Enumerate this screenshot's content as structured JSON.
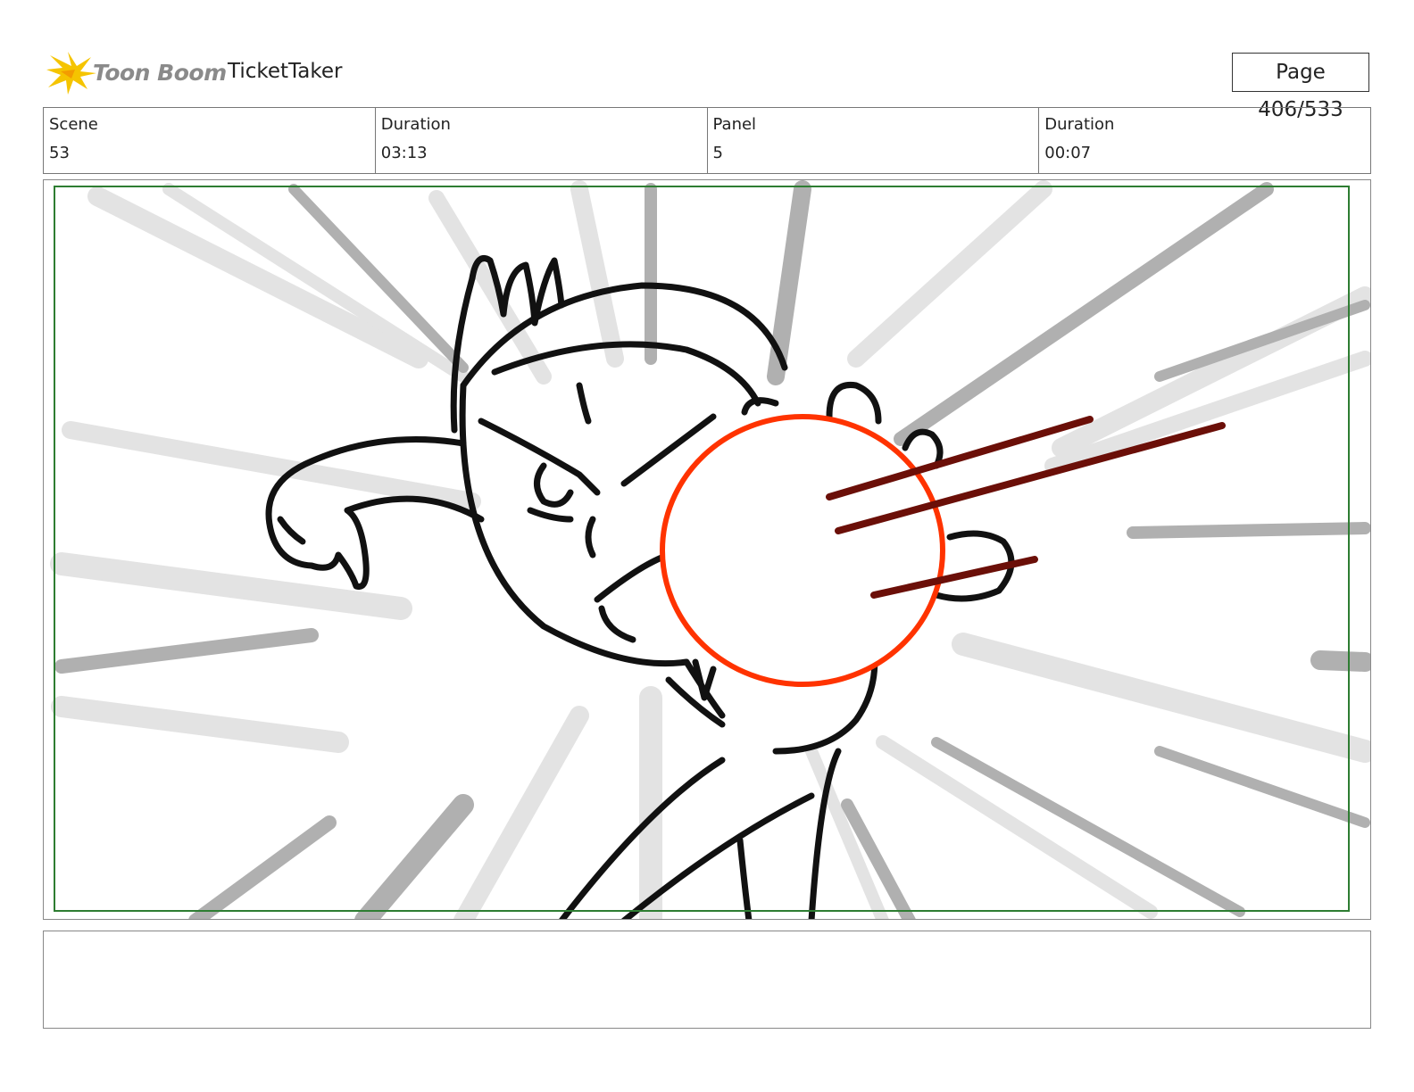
{
  "header": {
    "logo_text": "Toon Boom",
    "project_title": "TicketTaker",
    "page_label": "Page 406/533"
  },
  "info": {
    "scene_label": "Scene",
    "scene_value": "53",
    "scene_duration_label": "Duration",
    "scene_duration_value": "03:13",
    "panel_label": "Panel",
    "panel_value": "5",
    "panel_duration_label": "Duration",
    "panel_duration_value": "00:07"
  },
  "colors": {
    "logo_star": "#f5c400",
    "safe_frame": "#2e7d32",
    "impact_circle": "#ff3300",
    "speed_lines": "#6b0f08",
    "burst_light": "#e3e3e3",
    "burst_dark": "#b0b0b0"
  },
  "notes": ""
}
